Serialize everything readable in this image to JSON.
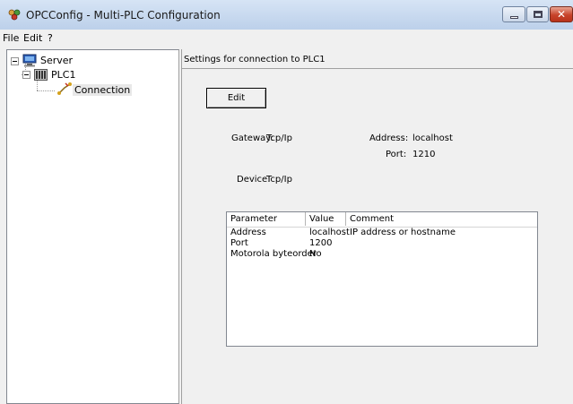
{
  "window": {
    "title": "OPCConfig - Multi-PLC Configuration"
  },
  "menu": [
    "File",
    "Edit",
    "?"
  ],
  "tree": {
    "root": {
      "label": "Server",
      "icon": "computer-icon"
    },
    "child": {
      "label": "PLC1",
      "icon": "plc-icon"
    },
    "leaf": {
      "label": "Connection",
      "icon": "connection-icon"
    }
  },
  "panel": {
    "title": "Settings for connection to PLC1",
    "edit_label": "Edit",
    "gateway_label": "Gateway:",
    "gateway_value": "Tcp/Ip",
    "address_label": "Address:",
    "address_value": "localhost",
    "port_label": "Port:",
    "port_value": "1210",
    "device_label": "Device:",
    "device_value": "Tcp/Ip"
  },
  "table": {
    "columns": [
      "Parameter",
      "Value",
      "Comment"
    ],
    "rows": [
      [
        "Address",
        "localhost",
        "IP address or hostname"
      ],
      [
        "Port",
        "1200",
        ""
      ],
      [
        "Motorola byteorder",
        "No",
        ""
      ]
    ]
  },
  "colors": {
    "titlebar": "#d6e4f5",
    "close_button": "#c7432b",
    "background": "#f0f0f0"
  }
}
